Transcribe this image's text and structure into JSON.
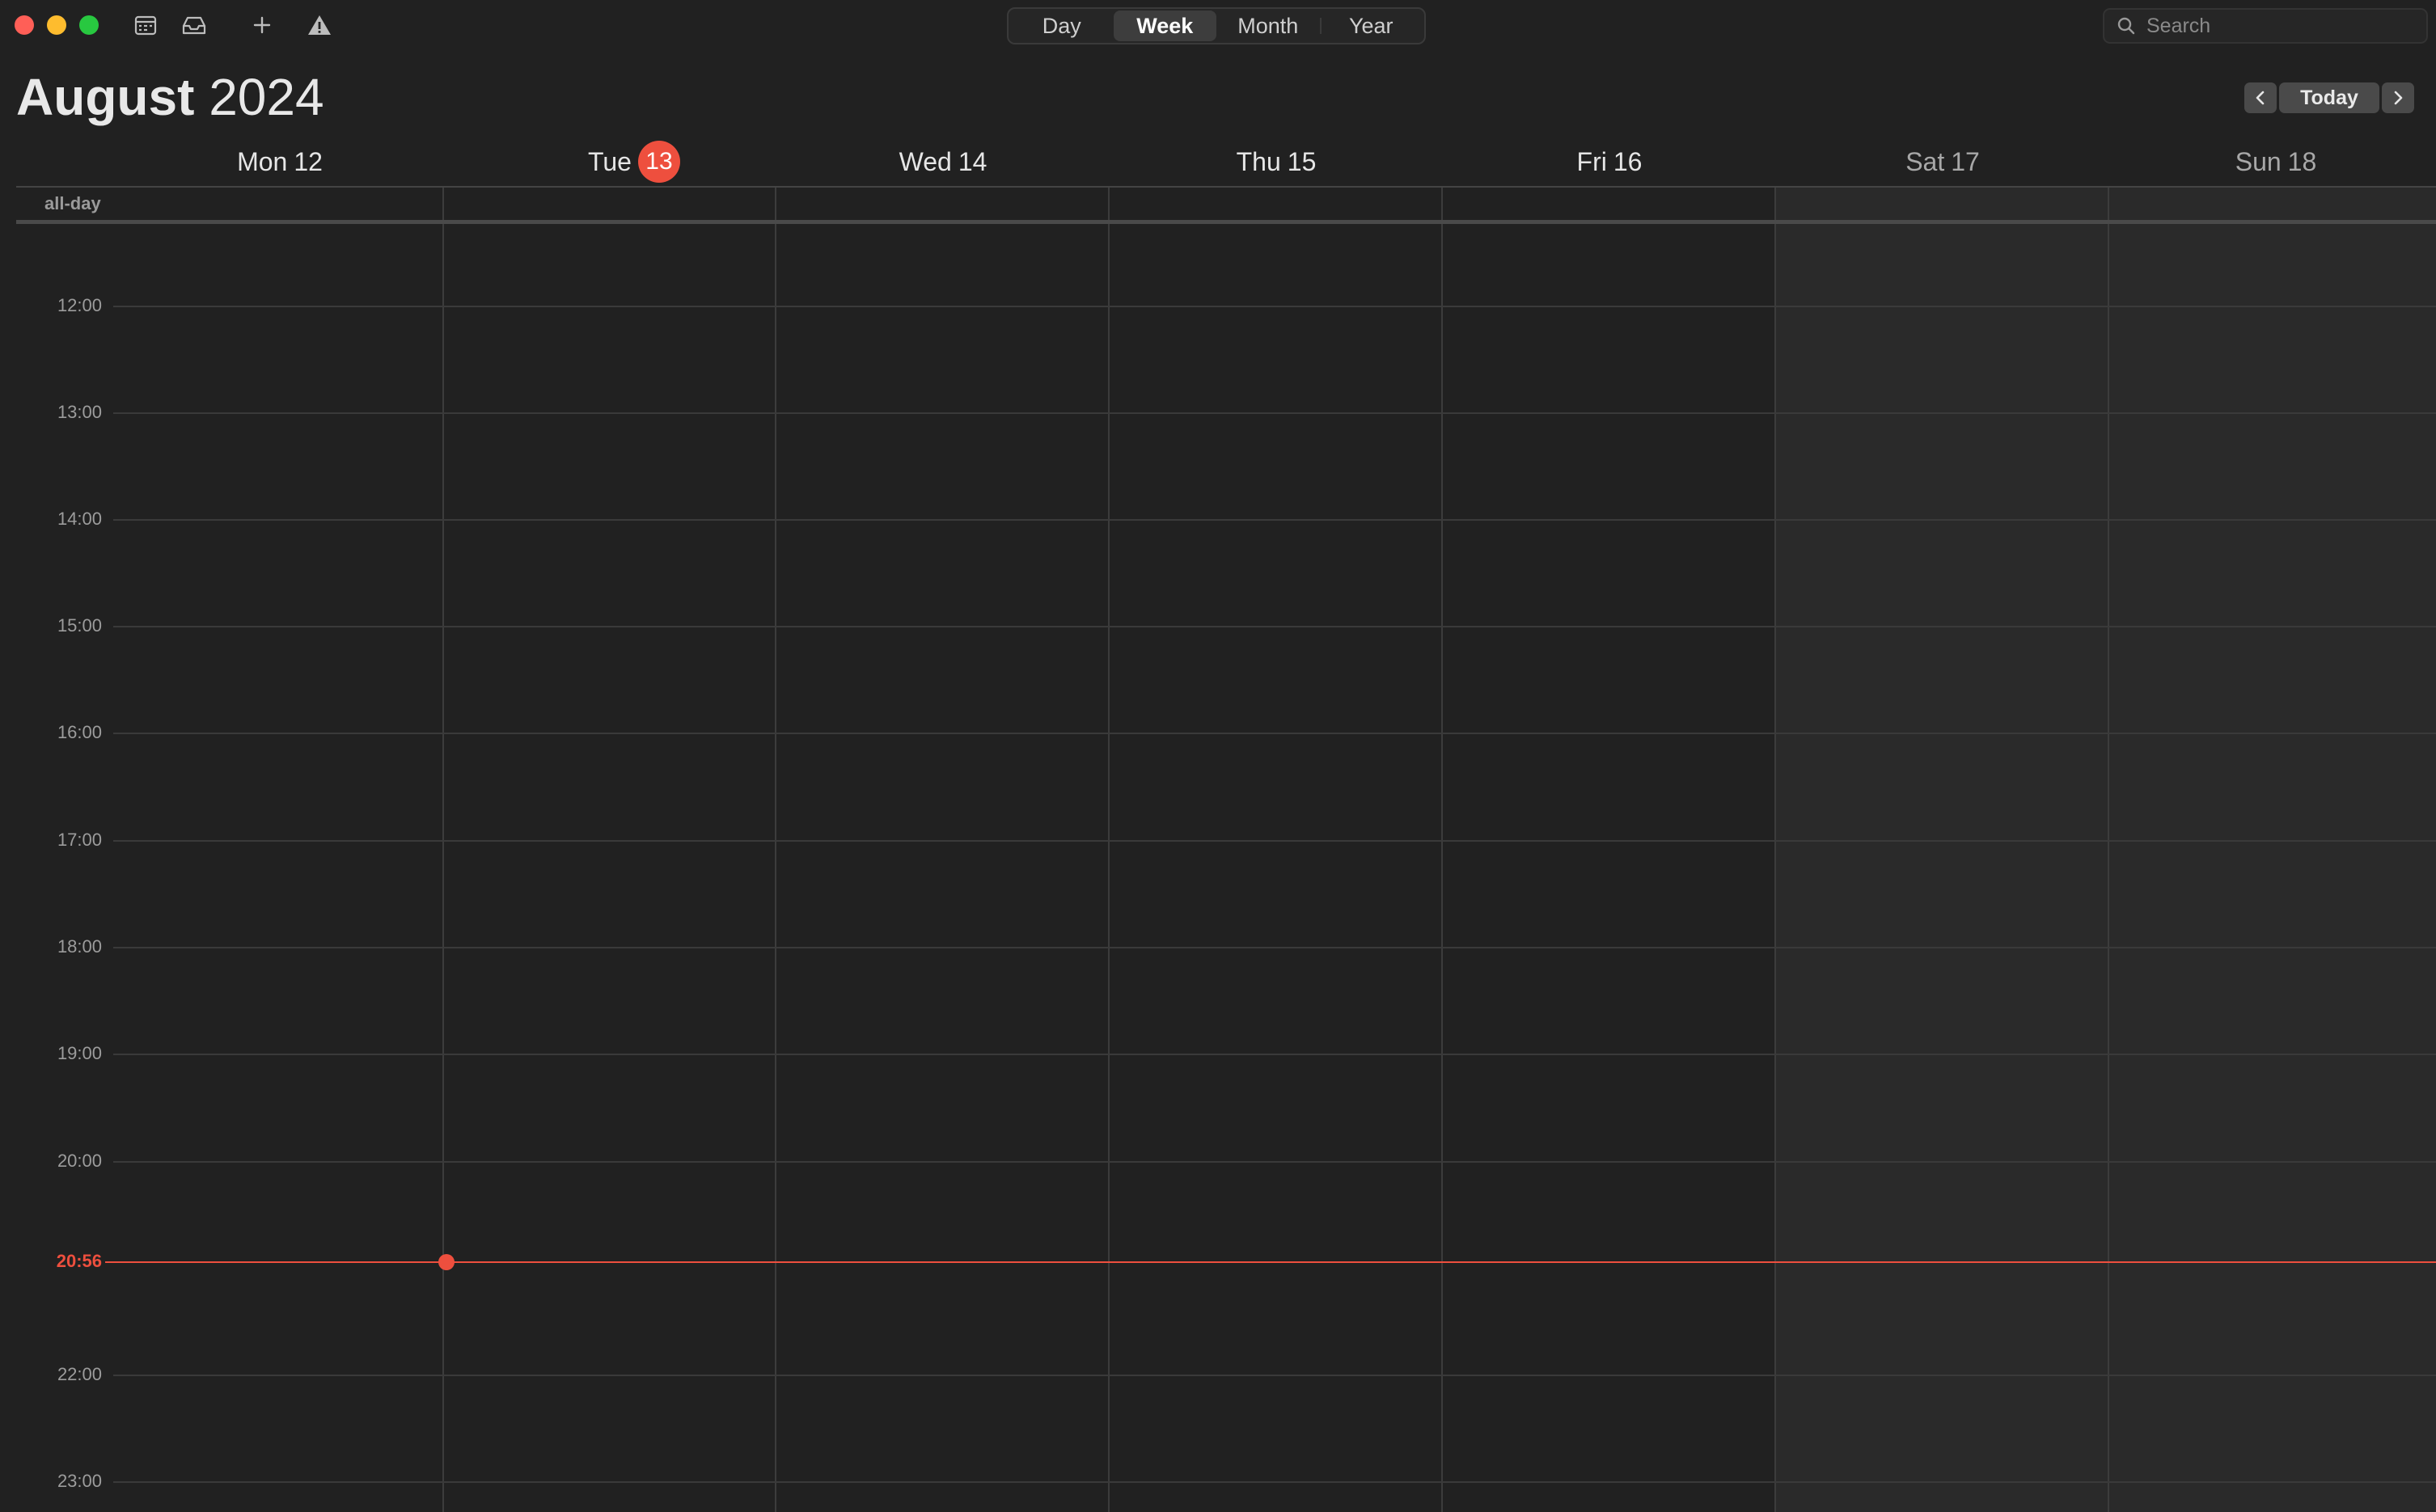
{
  "toolbar": {
    "icons": [
      "calendars-icon",
      "inbox-icon",
      "add-icon",
      "warning-icon"
    ]
  },
  "view_switcher": {
    "options": [
      "Day",
      "Week",
      "Month",
      "Year"
    ],
    "selected": "Week"
  },
  "search": {
    "placeholder": "Search",
    "value": ""
  },
  "header": {
    "month": "August",
    "year": "2024",
    "today_label": "Today"
  },
  "week": {
    "days": [
      {
        "name": "Mon",
        "num": "12"
      },
      {
        "name": "Tue",
        "num": "13",
        "is_today": true
      },
      {
        "name": "Wed",
        "num": "14"
      },
      {
        "name": "Thu",
        "num": "15"
      },
      {
        "name": "Fri",
        "num": "16"
      },
      {
        "name": "Sat",
        "num": "17",
        "weekend": true
      },
      {
        "name": "Sun",
        "num": "18",
        "weekend": true
      }
    ],
    "all_day_label": "all-day"
  },
  "time_grid": {
    "hours": [
      "12:00",
      "13:00",
      "14:00",
      "15:00",
      "16:00",
      "17:00",
      "18:00",
      "19:00",
      "20:00",
      "22:00",
      "23:00"
    ],
    "current_time": "20:56"
  },
  "colors": {
    "accent": "#ee4f3e",
    "background": "#212121",
    "weekend_background": "#2a2a2a"
  }
}
